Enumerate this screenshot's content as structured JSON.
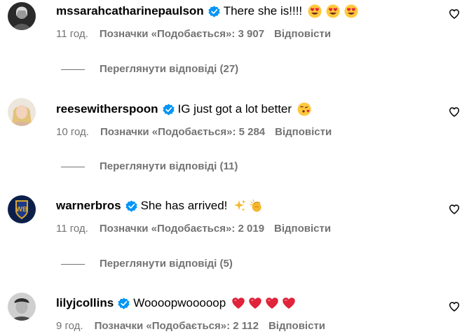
{
  "colors": {
    "text": "#000000",
    "secondary": "#737373",
    "verified": "#0095F6",
    "heart_emoji": "#E0243A"
  },
  "comments": [
    {
      "username": "mssarahcatharinepaulson",
      "text": "There she is!!!!",
      "emoji_icons": [
        "heart-eyes-emoji",
        "heart-eyes-emoji",
        "heart-eyes-emoji"
      ],
      "time": "11 год.",
      "likes": "Позначки «Подобається»: 3 907",
      "reply": "Відповісти",
      "view_replies": "Переглянути відповіді (27)"
    },
    {
      "username": "reesewitherspoon",
      "text": "IG just got a lot better",
      "emoji_icons": [
        "kissing-heart-emoji"
      ],
      "time": "10 год.",
      "likes": "Позначки «Подобається»: 5 284",
      "reply": "Відповісти",
      "view_replies": "Переглянути відповіді (11)"
    },
    {
      "username": "warnerbros",
      "text": "She has arrived!",
      "emoji_icons": [
        "sparkles-emoji",
        "clapping-hands-emoji"
      ],
      "time": "11 год.",
      "likes": "Позначки «Подобається»: 2 019",
      "reply": "Відповісти",
      "view_replies": "Переглянути відповіді (5)"
    },
    {
      "username": "lilyjcollins",
      "text": "Wooooрwoooooр",
      "emoji_icons": [
        "red-heart-emoji",
        "red-heart-emoji",
        "red-heart-emoji",
        "red-heart-emoji"
      ],
      "time": "9 год.",
      "likes": "Позначки «Подобається»: 2 112",
      "reply": "Відповісти"
    }
  ]
}
